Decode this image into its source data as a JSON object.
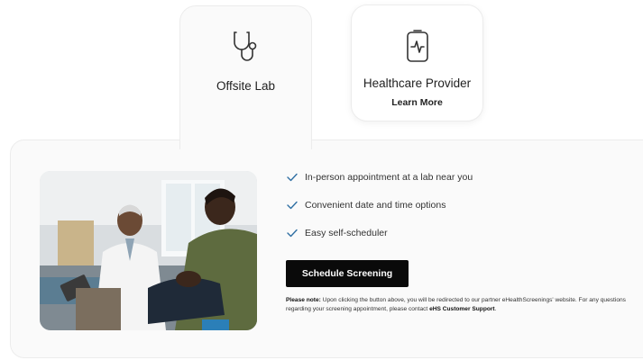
{
  "tabs": [
    {
      "label": "Offsite Lab",
      "icon": "stethoscope-icon"
    },
    {
      "label": "Healthcare Provider",
      "link": "Learn More",
      "icon": "clipboard-pulse-icon"
    }
  ],
  "features": [
    {
      "text": "In-person appointment at a lab near you"
    },
    {
      "text": "Convenient date and time options"
    },
    {
      "text": "Easy self-scheduler"
    }
  ],
  "cta": {
    "label": "Schedule Screening"
  },
  "note": {
    "lead": "Please note:",
    "body": " Upon clicking the button above, you will be redirected to our partner eHealthScreenings' website. For any questions regarding your screening appointment, please contact ",
    "link": "eHS Customer Support",
    "end": "."
  },
  "colors": {
    "accent_check": "#2f6fa3",
    "button_bg": "#0a0a0a",
    "panel_bg": "#fafafa"
  }
}
